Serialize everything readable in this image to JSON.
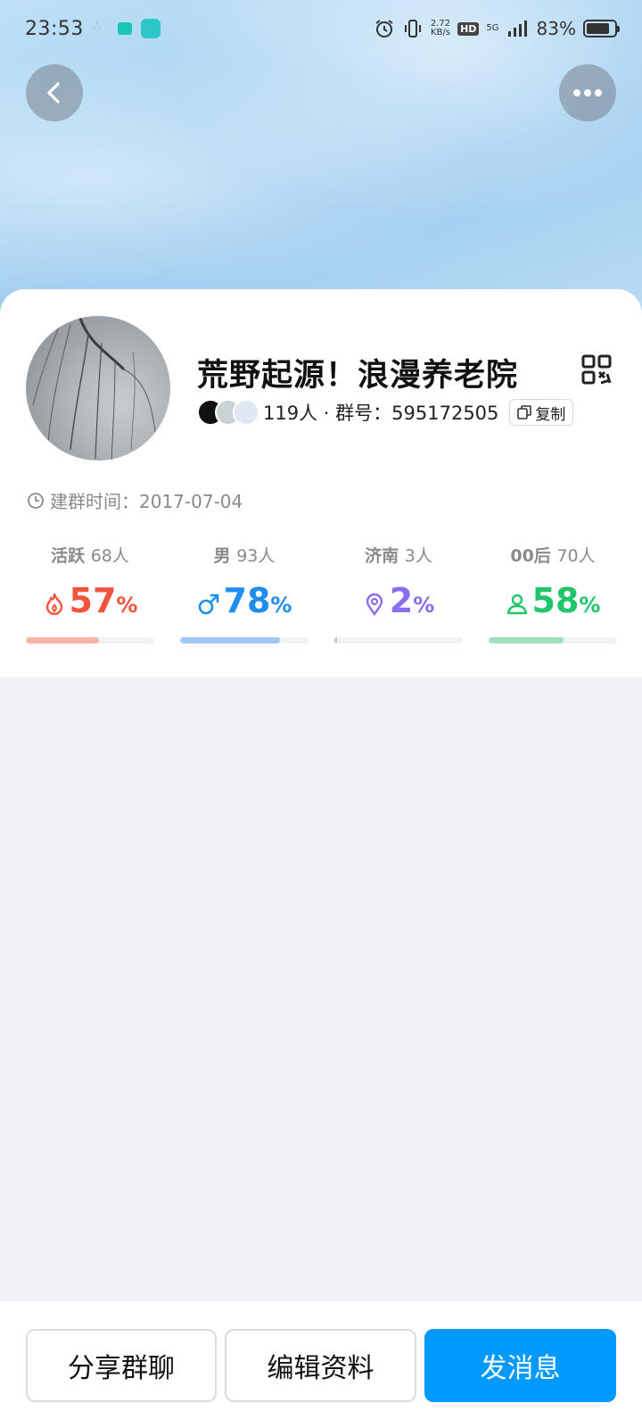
{
  "status_bar": {
    "time": "23:53",
    "net_speed_value": "2.72",
    "net_speed_unit": "KB/s",
    "hd_label": "HD",
    "network_label": "5G",
    "battery_text": "83%",
    "battery_level": 0.83
  },
  "group": {
    "name": "荒野起源！浪漫养老院",
    "member_count": "119人",
    "separator": "·",
    "id_label": "群号：",
    "id_value": "595172505",
    "copy_label": "复制",
    "created_label": "建群时间：",
    "created_date": "2017-07-04"
  },
  "stats": [
    {
      "label": "活跃",
      "count": "68人",
      "value": "57",
      "unit": "%",
      "percent": 0.57,
      "color": "#f5533d",
      "bar_color": "#f8b4a8",
      "icon": "flame-icon"
    },
    {
      "label": "男",
      "count": "93人",
      "value": "78",
      "unit": "%",
      "percent": 0.78,
      "color": "#1e8ff0",
      "bar_color": "#9fc8f8",
      "icon": "male-icon"
    },
    {
      "label": "济南",
      "count": "3人",
      "value": "2",
      "unit": "%",
      "percent": 0.02,
      "color": "#8a6df0",
      "bar_color": "#c3b5f5",
      "icon": "location-pin-icon"
    },
    {
      "label": "00后",
      "count": "70人",
      "value": "58",
      "unit": "%",
      "percent": 0.58,
      "color": "#22c66a",
      "bar_color": "#9fe0bc",
      "icon": "person-icon"
    }
  ],
  "actions": {
    "share": "分享群聊",
    "edit": "编辑资料",
    "send": "发消息"
  },
  "colors": {
    "primary": "#0099ff",
    "page_background": "#f1f1f6"
  }
}
